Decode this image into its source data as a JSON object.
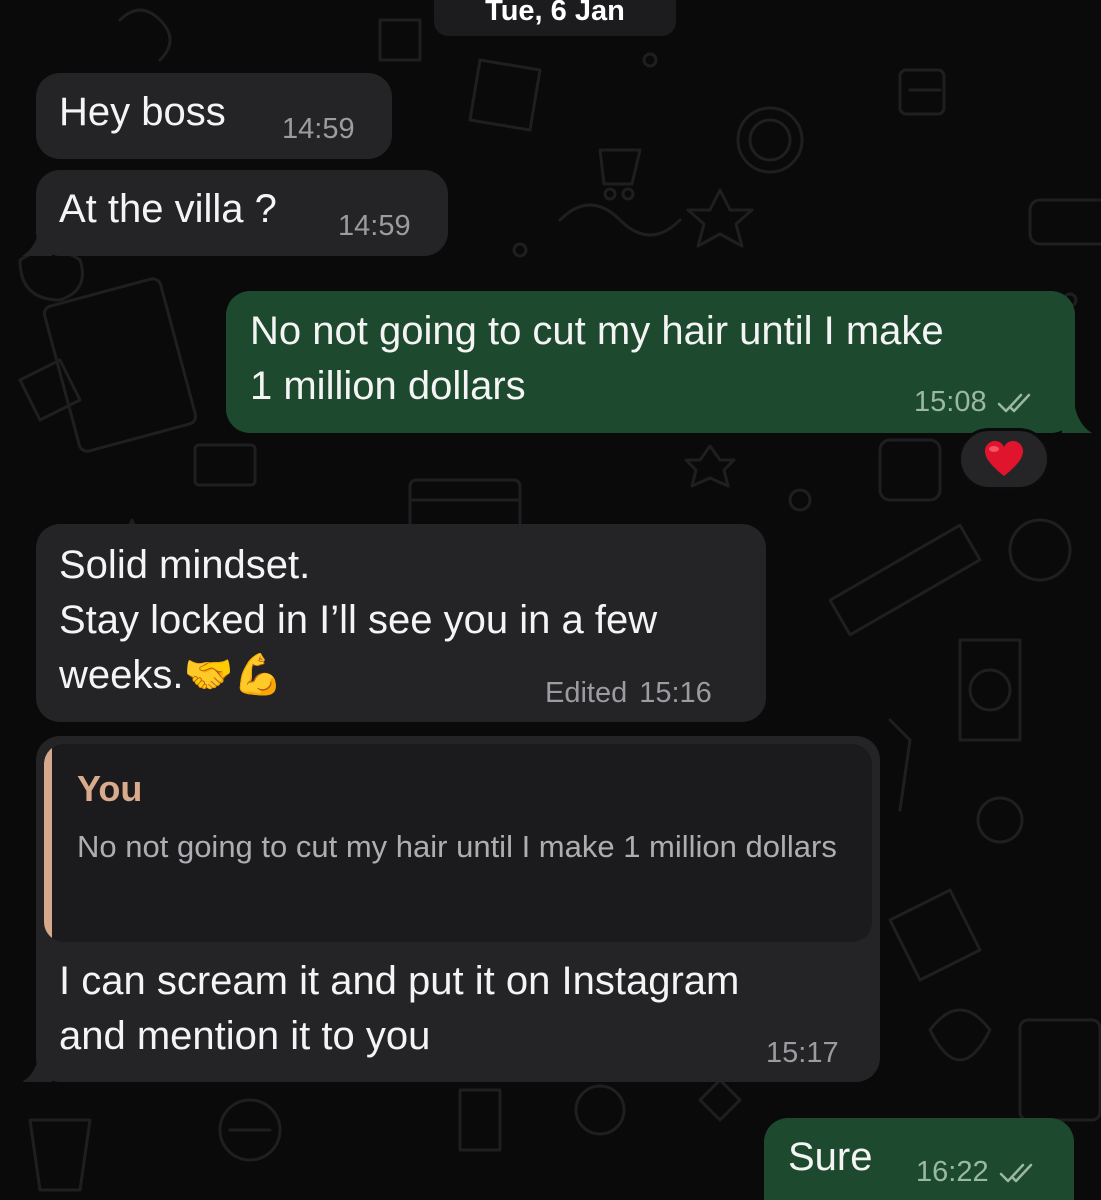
{
  "date_separator": "Tue, 6 Jan",
  "messages": [
    {
      "direction": "incoming",
      "text": "Hey boss",
      "time": "14:59"
    },
    {
      "direction": "incoming",
      "text": "At the villa ?",
      "time": "14:59"
    },
    {
      "direction": "outgoing",
      "text": "No not going to cut my hair until I make\n1 million dollars",
      "time": "15:08",
      "status": "read",
      "reaction": "❤️"
    },
    {
      "direction": "incoming",
      "text": "Solid mindset.\nStay locked in I’ll see you in a few\nweeks.🤝💪",
      "edited_label": "Edited",
      "time": "15:16"
    },
    {
      "direction": "incoming",
      "quote": {
        "author": "You",
        "text": "No not going to cut my hair until I make 1 million dollars"
      },
      "text": "I can scream it and put it on Instagram\nand mention it to you",
      "time": "15:17"
    },
    {
      "direction": "outgoing",
      "text": "Sure",
      "time": "16:22",
      "status": "read"
    }
  ],
  "icons": {
    "read_receipt": "double-check-icon",
    "reaction": "heart-icon"
  },
  "colors": {
    "background": "#0a0a0a",
    "incoming_bubble": "#242426",
    "outgoing_bubble": "#1d4a2e",
    "quote_accent": "#d6a98c",
    "meta_text": "#9b9ba0"
  }
}
